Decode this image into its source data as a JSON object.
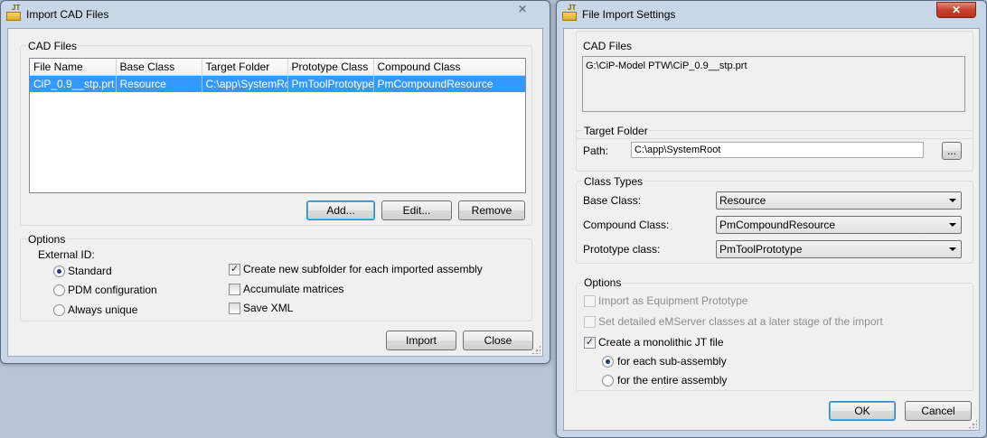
{
  "import_window": {
    "title": "Import CAD Files",
    "cad_files_group": "CAD Files",
    "columns": [
      "File Name",
      "Base Class",
      "Target Folder",
      "Prototype Class",
      "Compound Class"
    ],
    "rows": [
      [
        "CiP_0.9__stp.prt",
        "Resource",
        "C:\\app\\SystemRoot",
        "PmToolPrototype",
        "PmCompoundResource"
      ]
    ],
    "add_label": "Add...",
    "edit_label": "Edit...",
    "remove_label": "Remove",
    "options_group": "Options",
    "external_id_label": "External ID:",
    "radio_standard": "Standard",
    "radio_pdm": "PDM configuration",
    "radio_unique": "Always unique",
    "chk_subfolder": "Create new subfolder for each imported assembly",
    "chk_accumulate": "Accumulate matrices",
    "chk_savexml": "Save XML",
    "import_label": "Import",
    "close_label": "Close"
  },
  "settings_window": {
    "title": "File Import Settings",
    "cad_files_group": "CAD Files",
    "cad_files_value": "G:\\CiP-Model PTW\\CiP_0.9__stp.prt",
    "target_folder_group": "Target Folder",
    "path_label": "Path:",
    "path_value": "C:\\app\\SystemRoot",
    "browse_label": "...",
    "class_types_group": "Class Types",
    "base_class_label": "Base Class:",
    "base_class_value": "Resource",
    "compound_class_label": "Compound Class:",
    "compound_class_value": "PmCompoundResource",
    "prototype_class_label": "Prototype class:",
    "prototype_class_value": "PmToolPrototype",
    "options_group": "Options",
    "chk_equipment": "Import as Equipment Prototype",
    "chk_emserver": "Set detailed eMServer classes at a later stage of the import",
    "chk_monolithic": "Create a monolithic JT file",
    "radio_sub": "for each sub-assembly",
    "radio_entire": "for the entire assembly",
    "ok_label": "OK",
    "cancel_label": "Cancel"
  },
  "icons": {
    "app_icon": "jt-folder-icon",
    "close_icon": "x-close-icon",
    "check": "✓"
  },
  "colors": {
    "selection": "#3399ff",
    "close_active": "#c7422e",
    "titlebar": "#c8d6e8"
  }
}
